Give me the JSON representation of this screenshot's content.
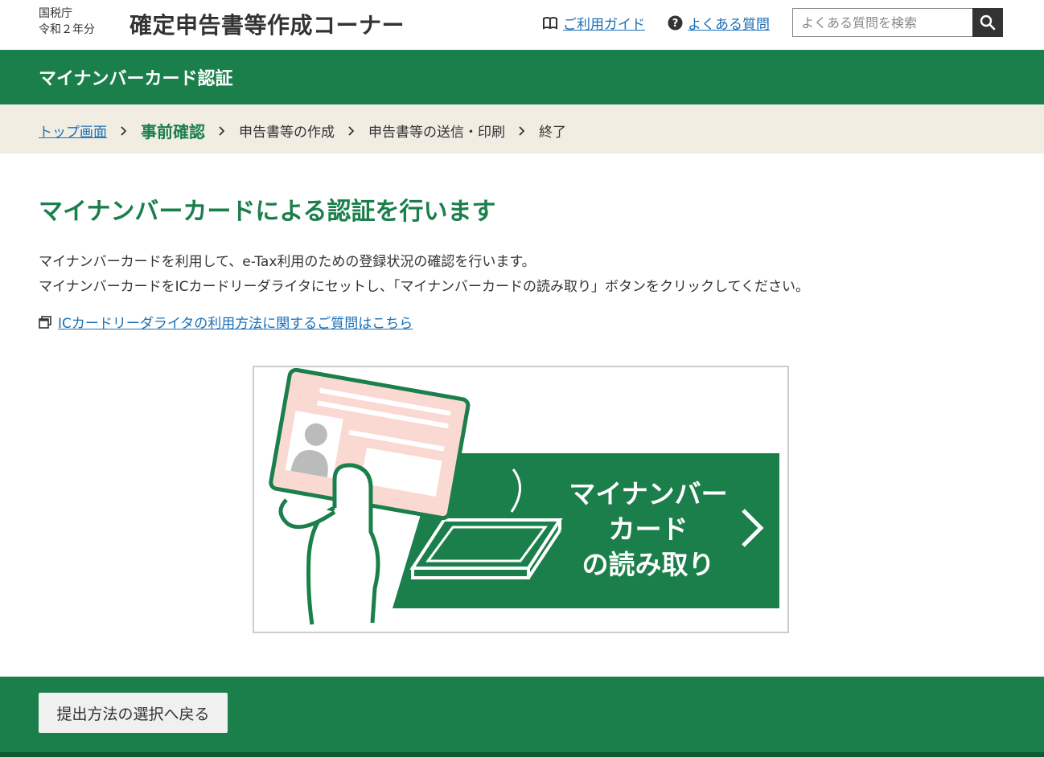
{
  "header": {
    "agency": "国税庁",
    "year": "令和２年分",
    "title": "確定申告書等作成コーナー",
    "guide_link": "ご利用ガイド",
    "faq_link": "よくある質問",
    "search_placeholder": "よくある質問を検索"
  },
  "section_bar": {
    "title": "マイナンバーカード認証"
  },
  "breadcrumb": {
    "items": [
      "トップ画面",
      "事前確認",
      "申告書等の作成",
      "申告書等の送信・印刷",
      "終了"
    ],
    "current_index": 1
  },
  "main": {
    "heading": "マイナンバーカードによる認証を行います",
    "line1": "マイナンバーカードを利用して、e-Tax利用のための登録状況の確認を行います。",
    "line2": "マイナンバーカードをICカードリーダライタにセットし、「マイナンバーカードの読み取り」ボタンをクリックしてください。",
    "faq_link": "ICカードリーダライタの利用方法に関するご質問はこちら",
    "read_button": [
      "マイナンバー",
      "カード",
      "の読み取り"
    ]
  },
  "footer": {
    "back_button": "提出方法の選択へ戻る"
  },
  "colors": {
    "brand_green": "#1b7f4b",
    "link_blue": "#1a6fb5",
    "breadcrumb_bg": "#f1ede2",
    "card_pink": "#fbd9d3"
  }
}
